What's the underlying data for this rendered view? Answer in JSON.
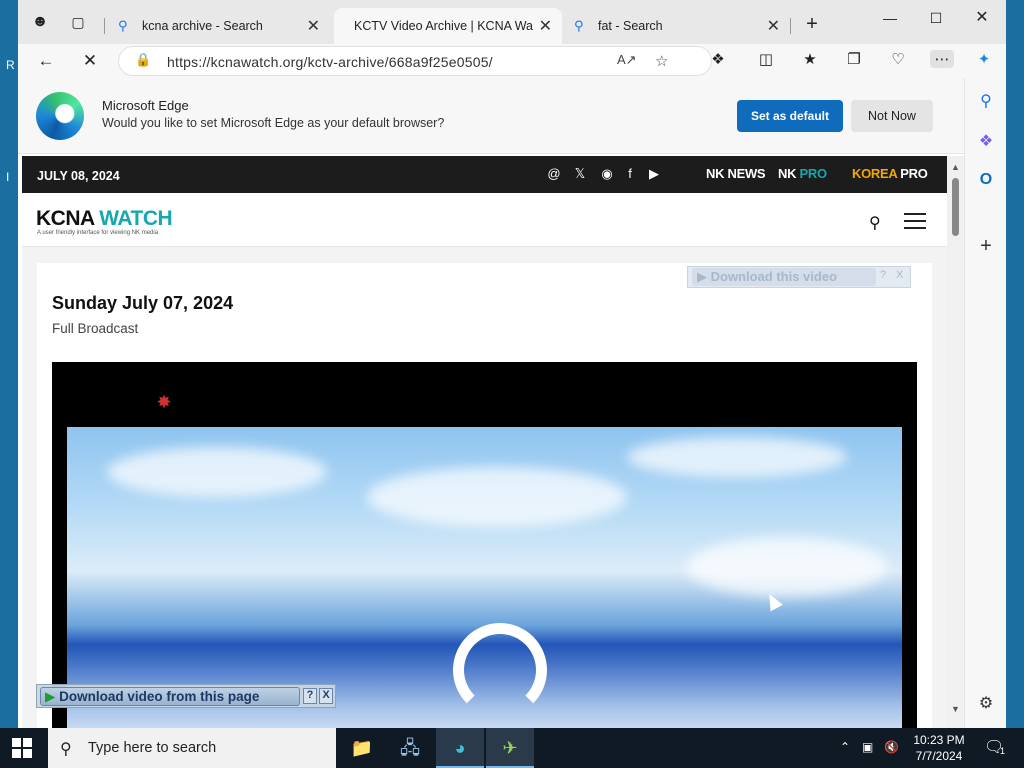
{
  "desktop": {
    "left_chars": [
      "R",
      "I"
    ]
  },
  "tabs": [
    {
      "title": "kcna archive - Search",
      "active": false,
      "icon": "search-icon"
    },
    {
      "title": "KCTV Video Archive | KCNA Wa",
      "active": true,
      "icon": "loading-icon"
    },
    {
      "title": "fat - Search",
      "active": false,
      "icon": "search-icon"
    }
  ],
  "address": {
    "url": "https://kcnawatch.org/kctv-archive/668a9f25e0505/"
  },
  "banner": {
    "title": "Microsoft Edge",
    "text": "Would you like to set Microsoft Edge as your default browser?",
    "set_default": "Set as default",
    "not_now": "Not Now"
  },
  "site": {
    "date": "JULY 08, 2024",
    "brands": {
      "nknews": "NK NEWS",
      "nkpro_a": "NK",
      "nkpro_b": "PRO",
      "korea_a": "KOREA",
      "korea_b": "PRO"
    },
    "logo_a": "KCNA",
    "logo_b": "WATCH",
    "logo_sub": "A user friendly interface for viewing NK media"
  },
  "post": {
    "date": "Sunday July 07, 2024",
    "subtitle": "Full Broadcast"
  },
  "overlays": {
    "download_top": "Download this video",
    "download_bottom": "Download video from this page",
    "help": "?",
    "close": "X"
  },
  "taskbar": {
    "search_placeholder": "Type here to search",
    "time": "10:23 PM",
    "date": "7/7/2024",
    "notification_count": "1"
  },
  "colors": {
    "accent": "#0f6cbd",
    "kcna_teal": "#16a7b0",
    "korea_pro": "#f2a900",
    "taskbar": "#101a24"
  }
}
